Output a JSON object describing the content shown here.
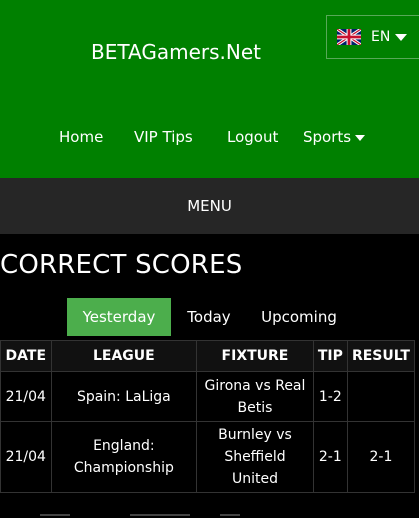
{
  "header": {
    "brand": "BETAGamers.Net",
    "language": {
      "label": "EN",
      "flag_icon": "uk-flag-icon"
    },
    "background_color": "#008000"
  },
  "nav": {
    "items": [
      {
        "label": "Home"
      },
      {
        "label": "VIP Tips"
      },
      {
        "label": "Logout"
      },
      {
        "label": "Sports"
      }
    ]
  },
  "menu": {
    "label": "MENU"
  },
  "section": {
    "title": "CORRECT SCORES"
  },
  "tabs": [
    {
      "label": "Yesterday",
      "active": true
    },
    {
      "label": "Today",
      "active": false
    },
    {
      "label": "Upcoming",
      "active": false
    }
  ],
  "table": {
    "headers": [
      "DATE",
      "LEAGUE",
      "FIXTURE",
      "TIP",
      "RESULT"
    ],
    "rows": [
      {
        "date": "21/04",
        "league": "Spain: LaLiga",
        "fixture": "Girona vs Real Betis",
        "tip": "1-2",
        "result": ""
      },
      {
        "date": "21/04",
        "league": "England: Championship",
        "fixture": "Burnley vs Sheffield United",
        "tip": "2-1",
        "result": "2-1"
      }
    ]
  },
  "colors": {
    "accent_tab": "#4cae4c",
    "menubar": "#262626"
  }
}
